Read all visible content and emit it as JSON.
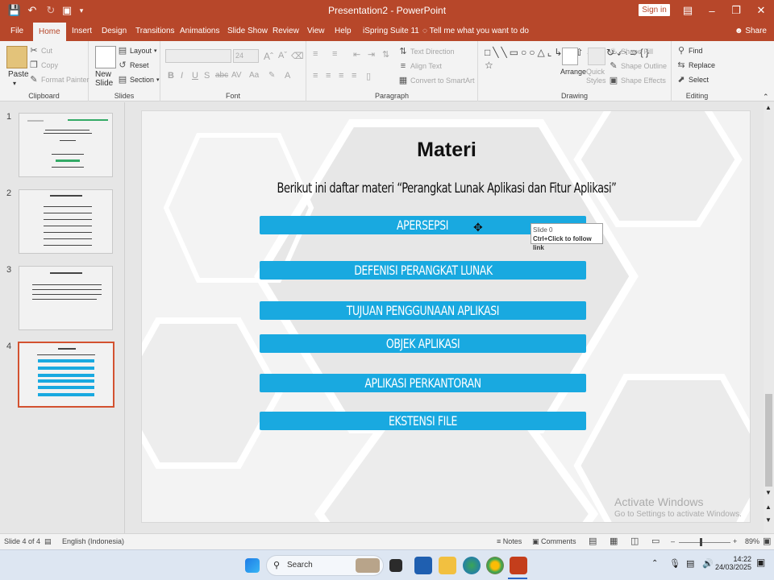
{
  "window": {
    "title": "Presentation2 - PowerPoint",
    "signin": "Sign in"
  },
  "tabs": [
    "File",
    "Home",
    "Insert",
    "Design",
    "Transitions",
    "Animations",
    "Slide Show",
    "Review",
    "View",
    "Help",
    "iSpring Suite 11"
  ],
  "tell_me": "Tell me what you want to do",
  "share": "Share",
  "ribbon": {
    "clipboard": {
      "label": "Clipboard",
      "paste": "Paste",
      "cut": "Cut",
      "copy": "Copy",
      "format_painter": "Format Painter"
    },
    "slides": {
      "label": "Slides",
      "new_slide": "New Slide",
      "layout": "Layout",
      "reset": "Reset",
      "section": "Section"
    },
    "font": {
      "label": "Font",
      "size": "24"
    },
    "paragraph": {
      "label": "Paragraph",
      "text_direction": "Text Direction",
      "align_text": "Align Text",
      "smartart": "Convert to SmartArt"
    },
    "drawing": {
      "label": "Drawing",
      "arrange": "Arrange",
      "quick_styles": "Quick Styles",
      "shape_fill": "Shape Fill",
      "shape_outline": "Shape Outline",
      "shape_effects": "Shape Effects"
    },
    "editing": {
      "label": "Editing",
      "find": "Find",
      "replace": "Replace",
      "select": "Select"
    }
  },
  "thumbnails": [
    "1",
    "2",
    "3",
    "4"
  ],
  "slide": {
    "title": "Materi",
    "subtitle": "Berikut ini daftar materi “Perangkat Lunak Aplikasi dan Fitur Aplikasi”",
    "items": [
      "APERSEPSI",
      "DEFENISI PERANGKAT LUNAK",
      "TUJUAN PENGGUNAAN APLIKASI",
      "OBJEK APLIKASI",
      "APLIKASI PERKANTORAN",
      "EKSTENSI FILE"
    ],
    "tooltip_line1": "Slide 0",
    "tooltip_line2": "Ctrl+Click to follow link"
  },
  "watermark": {
    "line1": "Activate Windows",
    "line2": "Go to Settings to activate Windows."
  },
  "status": {
    "slide_of": "Slide 4 of 4",
    "language": "English (Indonesia)",
    "notes": "Notes",
    "comments": "Comments",
    "zoom": "89%"
  },
  "taskbar": {
    "search_placeholder": "Search",
    "time": "14:22",
    "date": "24/03/2025"
  }
}
